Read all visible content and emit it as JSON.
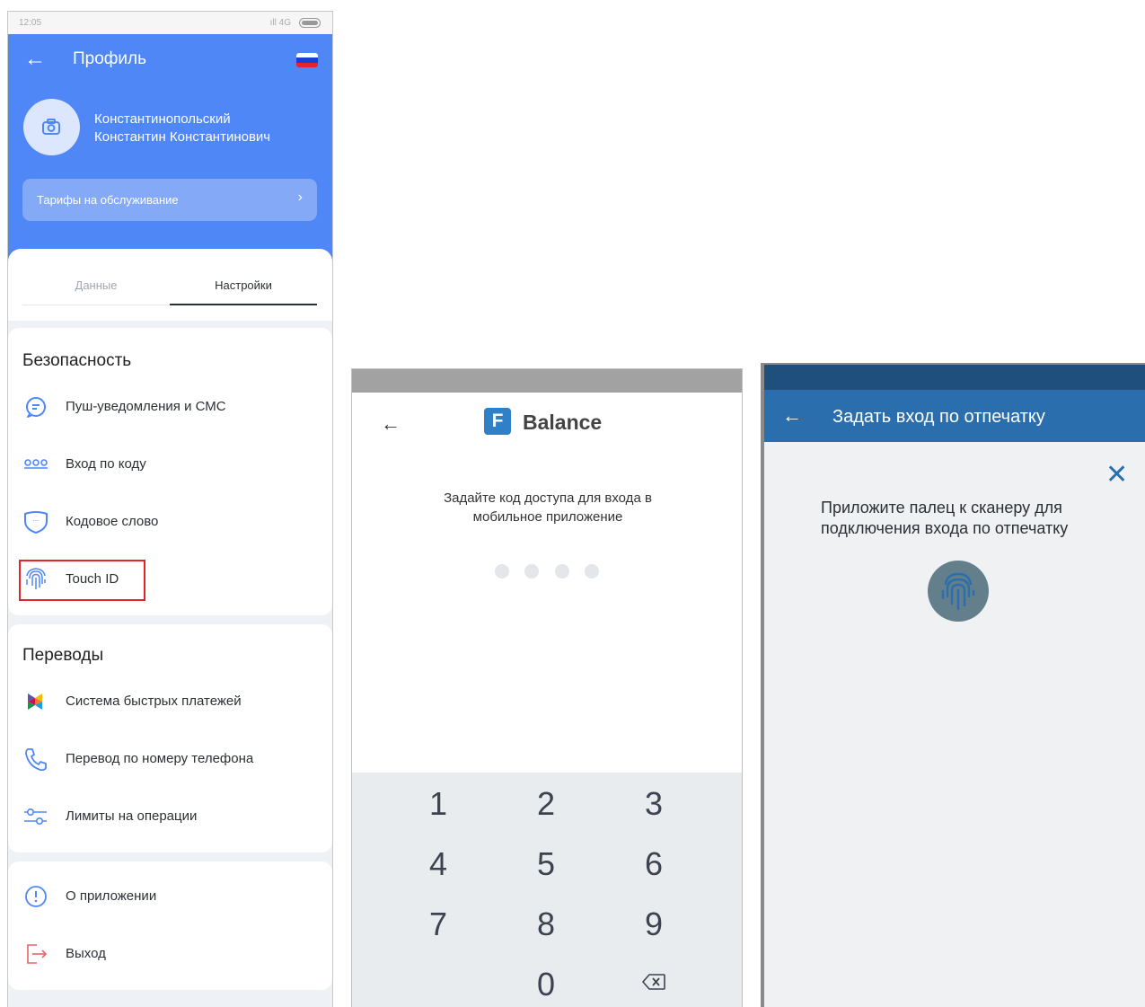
{
  "profile": {
    "status_time": "12:05",
    "status_net": "4G",
    "title": "Профиль",
    "user_line1": "Константинопольский",
    "user_line2": "Константин Константинович",
    "tariff_label": "Тарифы на обслуживание",
    "tariff_chevron": "›",
    "tabs": [
      {
        "label": "Данные",
        "active": false
      },
      {
        "label": "Настройки",
        "active": true
      }
    ],
    "security": {
      "title": "Безопасность",
      "items": [
        {
          "label": " Пуш-уведомления и СМС",
          "icon": "chat-bubble-icon"
        },
        {
          "label": "Вход по коду",
          "icon": "pin-dots-icon"
        },
        {
          "label": "Кодовое слово",
          "icon": "shield-icon"
        },
        {
          "label": "Touch ID",
          "icon": "fingerprint-icon",
          "highlighted": true
        }
      ]
    },
    "transfers": {
      "title": "Переводы",
      "items": [
        {
          "label": "Система быстрых платежей",
          "icon": "sbp-logo-icon"
        },
        {
          "label": "Перевод по номеру телефона",
          "icon": "phone-icon"
        },
        {
          "label": "Лимиты на операции",
          "icon": "sliders-icon"
        }
      ]
    },
    "misc": {
      "items": [
        {
          "label": "О приложении",
          "icon": "info-icon"
        },
        {
          "label": "Выход",
          "icon": "logout-icon"
        }
      ]
    },
    "colors": {
      "header": "#4f87f7",
      "accent_icon": "#4f87f7",
      "logout_icon": "#e8646a",
      "highlight": "#e1252b"
    }
  },
  "pin_setup": {
    "brand_letter": "F",
    "brand_name": "Balance",
    "prompt_line1": "Задайте код доступа для входа в",
    "prompt_line2": "мобильное приложение",
    "pin_length": 4,
    "keys": [
      "1",
      "2",
      "3",
      "4",
      "5",
      "6",
      "7",
      "8",
      "9",
      "0"
    ],
    "delete_icon": "backspace-icon"
  },
  "fingerprint": {
    "title": "Задать вход по отпечатку",
    "close_glyph": "✕",
    "instruction_line1": "Приложите палец к сканеру для",
    "instruction_line2": "подключения входа по отпечатку",
    "colors": {
      "appbar": "#2a6eae",
      "statusbar": "#1e4f7d",
      "sensor": "#627f8b"
    }
  }
}
